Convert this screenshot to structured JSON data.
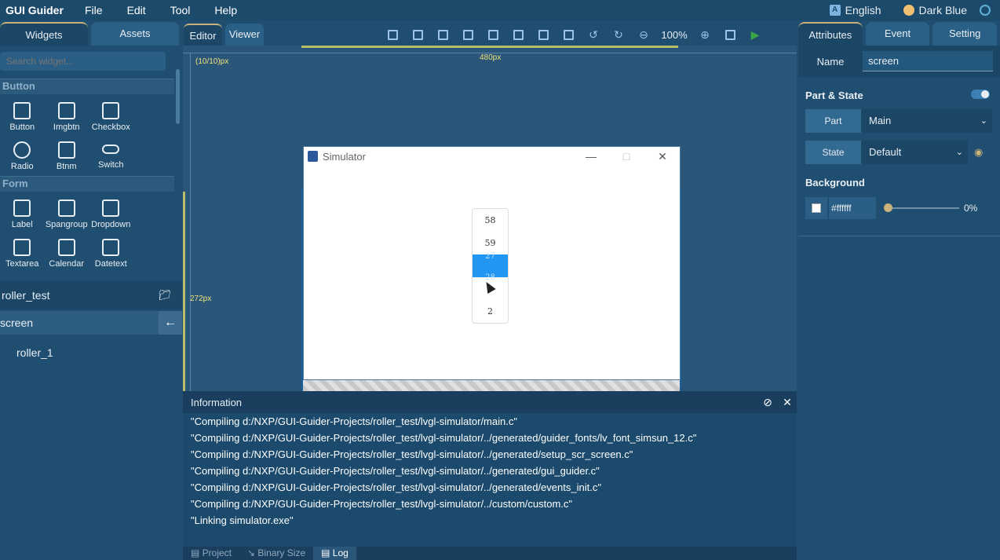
{
  "app": {
    "title": "GUI Guider"
  },
  "menu": [
    "File",
    "Edit",
    "Tool",
    "Help"
  ],
  "topright": {
    "language": "English",
    "theme": "Dark Blue"
  },
  "left": {
    "tabs": [
      "Widgets",
      "Assets"
    ],
    "search_placeholder": "Search widget...",
    "sections": [
      {
        "name": "Button",
        "items": [
          "Button",
          "Imgbtn",
          "Checkbox",
          "Radio",
          "Btnm",
          "Switch"
        ]
      },
      {
        "name": "Form",
        "items": [
          "Label",
          "Spangroup",
          "Dropdown",
          "Textarea",
          "Calendar",
          "Datetext"
        ]
      }
    ],
    "project_name": "roller_test",
    "screen_name": "screen",
    "tree_item": "roller_1"
  },
  "editor": {
    "tabs": [
      "Editor",
      "Viewer"
    ],
    "zoom": "100%",
    "coord": "(10/10)px",
    "width_label": "480px",
    "height_label": "272px"
  },
  "simulator": {
    "title": "Simulator",
    "roller_items": [
      "58",
      "59",
      "27",
      "28",
      "2"
    ]
  },
  "info": {
    "title": "Information",
    "log": [
      "\"Compiling d:/NXP/GUI-Guider-Projects/roller_test/lvgl-simulator/main.c\"",
      "\"Compiling d:/NXP/GUI-Guider-Projects/roller_test/lvgl-simulator/../generated/guider_fonts/lv_font_simsun_12.c\"",
      "\"Compiling d:/NXP/GUI-Guider-Projects/roller_test/lvgl-simulator/../generated/setup_scr_screen.c\"",
      "\"Compiling d:/NXP/GUI-Guider-Projects/roller_test/lvgl-simulator/../generated/gui_guider.c\"",
      "\"Compiling d:/NXP/GUI-Guider-Projects/roller_test/lvgl-simulator/../generated/events_init.c\"",
      "\"Compiling d:/NXP/GUI-Guider-Projects/roller_test/lvgl-simulator/../custom/custom.c\"",
      "\"Linking simulator.exe\""
    ],
    "bottom_tabs": [
      "Project",
      "Binary Size",
      "Log"
    ]
  },
  "right": {
    "tabs": [
      "Attributes",
      "Event",
      "Setting"
    ],
    "name_label": "Name",
    "name_value": "screen",
    "part_state_title": "Part & State",
    "part_label": "Part",
    "part_value": "Main",
    "state_label": "State",
    "state_value": "Default",
    "background_title": "Background",
    "bg_color": "#ffffff",
    "bg_opacity": "0%"
  },
  "colors": {
    "accent": "#c9b37a",
    "selection": "#2196f3",
    "panel": "#1f4e70"
  }
}
